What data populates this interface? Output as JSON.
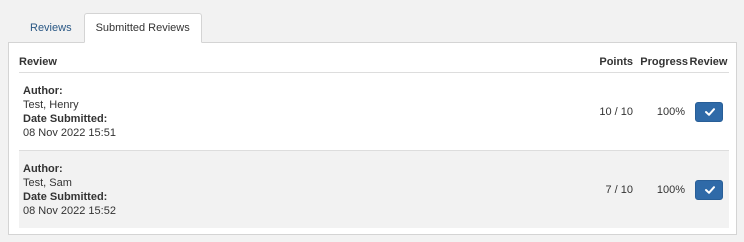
{
  "tabs": [
    {
      "label": "Reviews",
      "active": false
    },
    {
      "label": "Submitted Reviews",
      "active": true
    }
  ],
  "table": {
    "headers": {
      "review": "Review",
      "points": "Points",
      "progress": "Progress",
      "review_action": "Review"
    },
    "rows": [
      {
        "author_label": "Author:",
        "author": "Test, Henry",
        "date_label": "Date Submitted:",
        "date": "08 Nov 2022 15:51",
        "points": "10 / 10",
        "progress": "100%",
        "action_icon": "check-icon"
      },
      {
        "author_label": "Author:",
        "author": "Test, Sam",
        "date_label": "Date Submitted:",
        "date": "08 Nov 2022 15:52",
        "points": "7 / 10",
        "progress": "100%",
        "action_icon": "check-icon"
      }
    ]
  },
  "colors": {
    "link": "#2a5885",
    "button": "#2f6aa8",
    "alt_row": "#f2f2f2"
  }
}
